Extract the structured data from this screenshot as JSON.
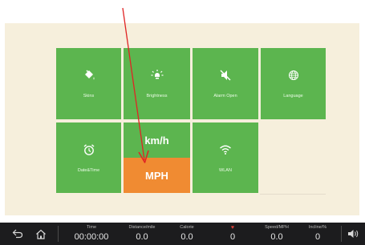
{
  "tiles": {
    "skins": {
      "label": "Skins",
      "icon": "paint-bucket-icon"
    },
    "brightness": {
      "label": "Brightness",
      "icon": "brightness-icon"
    },
    "alarm": {
      "label": "Alarm Open",
      "icon": "speaker-mute-icon"
    },
    "language": {
      "label": "Language",
      "icon": "globe-icon"
    },
    "datetime": {
      "label": "Date&Time",
      "icon": "alarm-clock-icon"
    },
    "unit": {
      "option_km": "km/h",
      "option_mph": "MPH",
      "selected": "MPH"
    },
    "wlan": {
      "label": "WLAN",
      "icon": "wifi-icon"
    }
  },
  "statusbar": {
    "time_label": "Time",
    "time_value": "00:00:00",
    "distance_label": "Distance/mile",
    "distance_value": "0.0",
    "calorie_label": "Calorie",
    "calorie_value": "0.0",
    "heart_label": "♥",
    "heart_value": "0",
    "speed_label": "Speed/MPH",
    "speed_value": "0.0",
    "incline_label": "Incline/%",
    "incline_value": "0"
  },
  "colors": {
    "tile_green": "#5cb54f",
    "selected_orange": "#f08b32",
    "background": "#f6efdc",
    "statusbar": "#1c1c1e",
    "annotation_arrow": "#e02424",
    "heart": "#e0413b"
  }
}
